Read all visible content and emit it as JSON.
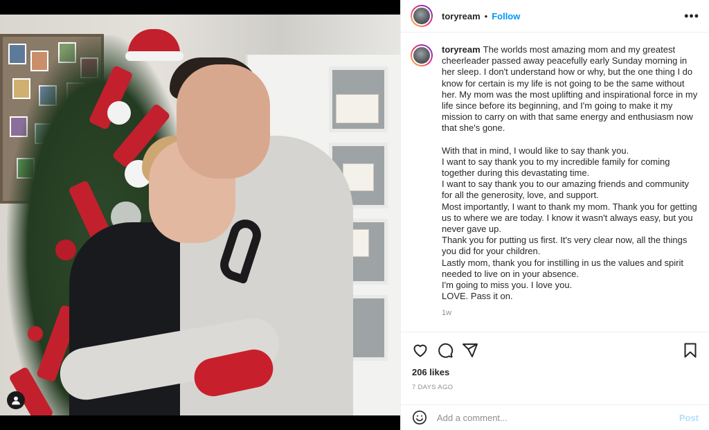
{
  "post": {
    "username": "toryream",
    "follow_label": "Follow",
    "more_icon": "more-horizontal-icon",
    "caption": {
      "username": "toryream",
      "paragraph1": "The worlds most amazing mom and my greatest cheerleader passed away peacefully early Sunday morning in her sleep. I don't understand how or why, but the one thing I do know for certain is my life is not going to be the same without her. My mom was the most uplifting and inspirational force in my life since before its beginning, and I'm going to make it my mission to carry on with that same energy and enthusiasm now that she's gone.",
      "lines": [
        "With that in mind, I would like to say thank you.",
        "I want to say thank you to my incredible family for coming together during this devastating time.",
        "I want to say thank you to our amazing friends and community for all the generosity, love, and support.",
        "Most importantly, I want to thank my mom. Thank you for getting us to where we are today. I know it wasn't always easy, but you never gave up.",
        "Thank you for putting us first. It's very clear now, all the things you did for your children.",
        "Lastly mom, thank you for instilling in us the values and spirit needed to live on in your absence.",
        "I'm going to miss you. I love you.",
        "LOVE. Pass it on."
      ],
      "time_ago": "1w"
    },
    "likes": "206 likes",
    "date": "7 DAYS AGO",
    "comment_placeholder": "Add a comment...",
    "post_label": "Post"
  },
  "colors": {
    "follow_blue": "#0095f6",
    "post_disabled": "#b2dffc",
    "muted_text": "#8e8e8e"
  }
}
